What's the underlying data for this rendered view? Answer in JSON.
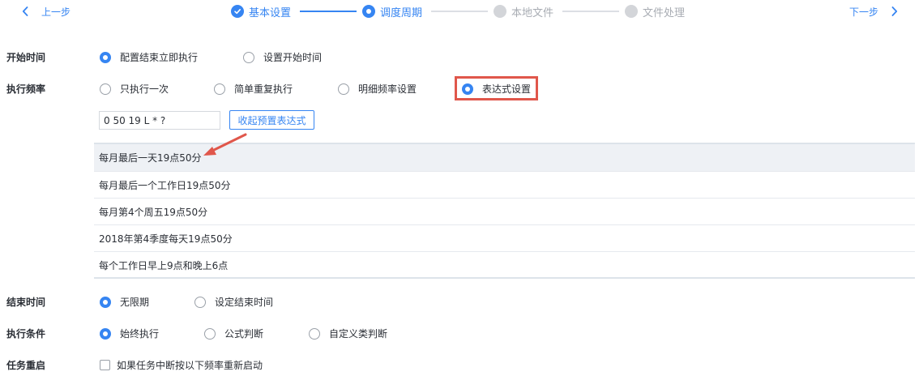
{
  "nav": {
    "prev_label": "上一步",
    "next_label": "下一步"
  },
  "steps": [
    {
      "label": "基本设置",
      "state": "done"
    },
    {
      "label": "调度周期",
      "state": "active"
    },
    {
      "label": "本地文件",
      "state": "todo"
    },
    {
      "label": "文件处理",
      "state": "todo"
    }
  ],
  "start_time": {
    "label": "开始时间",
    "options": [
      "配置结束立即执行",
      "设置开始时间"
    ],
    "selected": "配置结束立即执行"
  },
  "frequency": {
    "label": "执行频率",
    "options": [
      "只执行一次",
      "简单重复执行",
      "明细频率设置",
      "表达式设置"
    ],
    "selected": "表达式设置"
  },
  "expression": {
    "value": "0 50 19 L * ?",
    "collapse_button": "收起预置表达式"
  },
  "presets": [
    "每月最后一天19点50分",
    "每月最后一个工作日19点50分",
    "每月第4个周五19点50分",
    "2018年第4季度每天19点50分",
    "每个工作日早上9点和晚上6点"
  ],
  "end_time": {
    "label": "结束时间",
    "options": [
      "无限期",
      "设定结束时间"
    ],
    "selected": "无限期"
  },
  "condition": {
    "label": "执行条件",
    "options": [
      "始终执行",
      "公式判断",
      "自定义类判断"
    ],
    "selected": "始终执行"
  },
  "restart": {
    "label": "任务重启",
    "checkbox_label": "如果任务中断按以下频率重新启动",
    "checked": false
  },
  "colors": {
    "accent": "#3685f2",
    "annotation": "#e0574b",
    "inactive": "#d3d5d9"
  }
}
